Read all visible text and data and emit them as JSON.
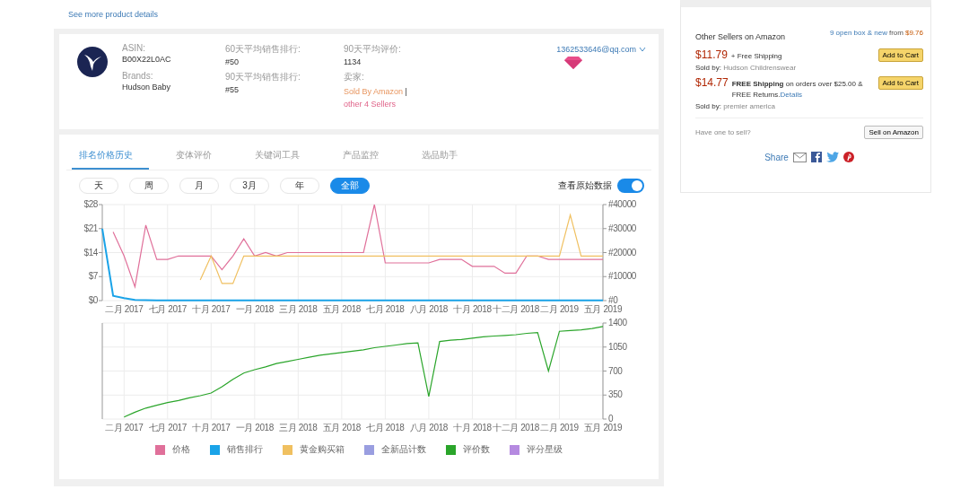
{
  "header_link": "See more product details",
  "product": {
    "fields": [
      {
        "label": "ASIN:",
        "value": "B00X22L0AC",
        "kind": "plain"
      },
      {
        "label": "60天平均销售排行:",
        "value": "#50",
        "kind": "plain"
      },
      {
        "label": "90天平均评价:",
        "value": "1134",
        "kind": "plain"
      },
      {
        "label": "Brands:",
        "value": "Hudson Baby",
        "kind": "link"
      },
      {
        "label": "90天平均销售排行:",
        "value": "#55",
        "kind": "plain"
      },
      {
        "label": "卖家:",
        "kind": "seller",
        "amazon": "Sold By Amazon",
        "separator": "|",
        "others": "other 4 Sellers"
      }
    ],
    "account": "1362533646@qq.com"
  },
  "tabs": [
    {
      "label": "排名价格历史",
      "selected": true
    },
    {
      "label": "变体评价",
      "selected": false
    },
    {
      "label": "关键词工具",
      "selected": false
    },
    {
      "label": "产品监控",
      "selected": false
    },
    {
      "label": "选品助手",
      "selected": false
    }
  ],
  "ranges": [
    {
      "label": "天",
      "selected": false
    },
    {
      "label": "周",
      "selected": false
    },
    {
      "label": "月",
      "selected": false
    },
    {
      "label": "3月",
      "selected": false
    },
    {
      "label": "年",
      "selected": false
    },
    {
      "label": "全部",
      "selected": true
    }
  ],
  "toggle": {
    "label": "查看原始数据",
    "on": true
  },
  "price_chart": {
    "chart_data": {
      "type": "line",
      "grid": true,
      "ylim": [
        0,
        28
      ],
      "y2lim": [
        0,
        40000
      ],
      "categories": [
        null,
        null,
        "二月 2017",
        null,
        null,
        null,
        "七月 2017",
        null,
        null,
        null,
        "十月 2017",
        null,
        null,
        null,
        "一月 2018",
        null,
        null,
        null,
        "三月 2018",
        null,
        null,
        null,
        "五月 2018",
        null,
        null,
        null,
        "七月 2018",
        null,
        null,
        null,
        "八月 2018",
        null,
        null,
        null,
        "十月 2018",
        null,
        null,
        null,
        "十二月 2018",
        null,
        null,
        null,
        "二月 2019",
        null,
        null,
        null,
        "五月 2019"
      ],
      "yticks": [
        {
          "value": 0,
          "label": "$0"
        },
        {
          "value": 7,
          "label": "$7"
        },
        {
          "value": 14,
          "label": "$14"
        },
        {
          "value": 21,
          "label": "$21"
        },
        {
          "value": 28,
          "label": "$28"
        }
      ],
      "y2ticks": [
        {
          "value": 0,
          "label": "#0"
        },
        {
          "value": 10000,
          "label": "#10000"
        },
        {
          "value": 20000,
          "label": "#20000"
        },
        {
          "value": 30000,
          "label": "#30000"
        },
        {
          "value": 40000,
          "label": "#40000"
        }
      ],
      "series": [
        {
          "color": "#e0709a",
          "values": [
            null,
            20,
            13,
            4,
            22,
            12,
            12,
            13,
            13,
            13,
            13,
            9,
            13,
            18,
            13,
            14,
            13,
            14,
            14,
            14,
            14,
            14,
            14,
            14,
            14,
            28,
            11,
            11,
            11,
            11,
            11,
            12,
            12,
            12,
            10,
            10,
            10,
            8,
            8,
            13,
            13,
            12,
            12,
            12,
            12,
            12,
            12
          ]
        },
        {
          "color": "#1aa3e8",
          "axis": "y2",
          "values": [
            30000,
            2000,
            1000,
            300,
            200,
            100,
            100,
            100,
            100,
            100,
            100,
            100,
            100,
            100,
            100,
            100,
            100,
            100,
            100,
            100,
            100,
            100,
            100,
            100,
            100,
            100,
            100,
            100,
            100,
            100,
            100,
            100,
            100,
            100,
            100,
            100,
            100,
            100,
            100,
            100,
            100,
            100,
            100,
            100,
            100,
            100,
            100
          ]
        },
        {
          "color": "#f0c060",
          "values": [
            null,
            null,
            null,
            null,
            null,
            null,
            null,
            null,
            null,
            6,
            13,
            5,
            5,
            13,
            13,
            13,
            13,
            13,
            13,
            13,
            13,
            13,
            13,
            13,
            13,
            13,
            13,
            13,
            13,
            13,
            13,
            13,
            13,
            13,
            13,
            13,
            13,
            13,
            13,
            13,
            13,
            13,
            13,
            25,
            13,
            13,
            13
          ]
        }
      ]
    }
  },
  "review_chart": {
    "chart_data": {
      "type": "line",
      "grid": true,
      "ylim": [
        0,
        1400
      ],
      "categories": [
        null,
        null,
        "二月 2017",
        null,
        null,
        null,
        "七月 2017",
        null,
        null,
        null,
        "十月 2017",
        null,
        null,
        null,
        "一月 2018",
        null,
        null,
        null,
        "三月 2018",
        null,
        null,
        null,
        "五月 2018",
        null,
        null,
        null,
        "七月 2018",
        null,
        null,
        null,
        "八月 2018",
        null,
        null,
        null,
        "十月 2018",
        null,
        null,
        null,
        "十二月 2018",
        null,
        null,
        null,
        "二月 2019",
        null,
        null,
        null,
        "五月 2019"
      ],
      "yticks": [
        {
          "value": 0,
          "label": "0"
        },
        {
          "value": 350,
          "label": "350"
        },
        {
          "value": 700,
          "label": "700"
        },
        {
          "value": 1050,
          "label": "1050"
        },
        {
          "value": 1400,
          "label": "1400"
        }
      ],
      "series": [
        {
          "color": "#2aa52a",
          "values": [
            null,
            null,
            30,
            100,
            160,
            200,
            240,
            270,
            310,
            340,
            380,
            470,
            580,
            670,
            720,
            760,
            810,
            840,
            870,
            900,
            930,
            950,
            970,
            990,
            1010,
            1040,
            1060,
            1080,
            1100,
            1110,
            330,
            1130,
            1150,
            1160,
            1180,
            1200,
            1210,
            1220,
            1230,
            1250,
            1260,
            700,
            1280,
            1290,
            1300,
            1320,
            1350
          ]
        }
      ]
    }
  },
  "legend": [
    {
      "label": "价格",
      "color": "#e0709a"
    },
    {
      "label": "销售排行",
      "color": "#1aa3e8"
    },
    {
      "label": "黄金购买箱",
      "color": "#f0c060"
    },
    {
      "label": "全新品计数",
      "color": "#9a9ee0"
    },
    {
      "label": "评价数",
      "color": "#2aa52a"
    },
    {
      "label": "评分星级",
      "color": "#b58ae0"
    }
  ],
  "sellers": {
    "title": "Other Sellers on Amazon",
    "offers_link": "9 open box & new",
    "from": "from",
    "from_price": "$9.76",
    "offers": [
      {
        "price": "$11.79",
        "shipping": "+ Free Shipping",
        "seller_label": "Sold by:",
        "seller": "Hudson Childrenswear",
        "button": "Add to Cart"
      },
      {
        "price": "$14.77",
        "shipping": "**FREE Shipping** on orders over $25.00 & FREE Returns.",
        "details": "Details",
        "seller_label": "Sold by:",
        "seller": "premier america",
        "button": "Add to Cart"
      }
    ],
    "sell_prompt": "Have one to sell?",
    "sell_button": "Sell on Amazon",
    "share": "Share"
  }
}
